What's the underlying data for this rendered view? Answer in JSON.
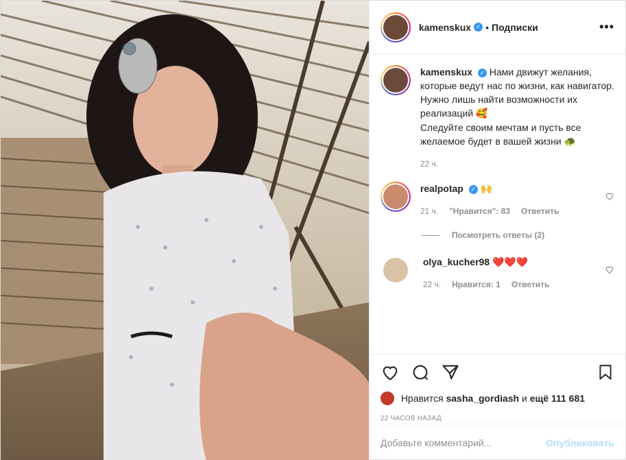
{
  "header": {
    "username": "kamenskux",
    "dot": "•",
    "follow_label": "Подписки",
    "more_label": "•••"
  },
  "caption": {
    "username": "kamenskux",
    "text1": "Нами движут желания, которые ведут нас по жизни, как навигатор. Нужно лишь найти возможности их реализаций",
    "emoji1": "🥰",
    "text2": "Следуйте своим мечтам и пусть все желаемое будет в вашей жизни",
    "emoji2": "🐢",
    "time": "22 ч."
  },
  "comments": [
    {
      "username": "realpotap",
      "text": "🙌",
      "time": "21 ч.",
      "likes": "\"Нравится\": 83",
      "reply": "Ответить",
      "view_replies": "Посмотреть ответы (2)"
    },
    {
      "username": "olya_kucher98",
      "text": "❤️❤️❤️",
      "time": "22 ч.",
      "likes": "Нравится: 1",
      "reply": "Ответить"
    }
  ],
  "likes": {
    "prefix": "Нравится",
    "user": "sasha_gordiash",
    "middle": "и",
    "count": "ещё 111 681"
  },
  "timestamp": "22 ЧАСОВ НАЗАД",
  "add_comment": {
    "placeholder": "Добавьте комментарий...",
    "publish_label": "Опубликовать"
  },
  "colors": {
    "accent": "#3897f0",
    "publish": "#b2dffc",
    "muted": "#8e8e8e",
    "heart": "#ed4956"
  }
}
